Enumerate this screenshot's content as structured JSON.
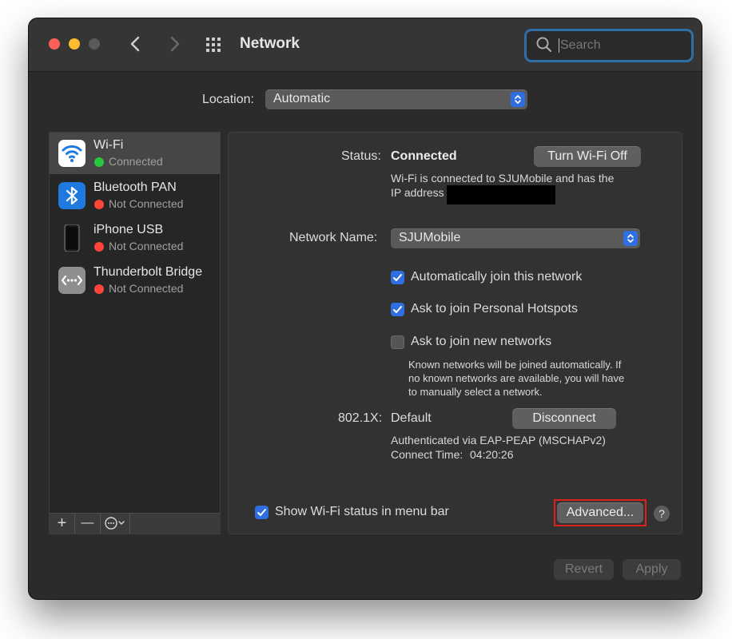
{
  "window": {
    "title": "Network",
    "search_placeholder": "Search"
  },
  "location": {
    "label": "Location:",
    "value": "Automatic"
  },
  "services": [
    {
      "name": "Wi-Fi",
      "status": "Connected",
      "status_color": "#2ac840",
      "icon": "wifi-icon"
    },
    {
      "name": "Bluetooth PAN",
      "status": "Not Connected",
      "status_color": "#ff453a",
      "icon": "bluetooth-icon"
    },
    {
      "name": "iPhone USB",
      "status": "Not Connected",
      "status_color": "#ff453a",
      "icon": "iphone-icon"
    },
    {
      "name": "Thunderbolt Bridge",
      "status": "Not Connected",
      "status_color": "#ff453a",
      "icon": "thunderbolt-bridge-icon"
    }
  ],
  "sidebar_toolbar": {
    "add": "+",
    "remove": "—"
  },
  "detail": {
    "status_label": "Status:",
    "status_value": "Connected",
    "turn_off_button": "Turn Wi-Fi Off",
    "status_desc_line1": "Wi-Fi is connected to SJUMobile and has the",
    "status_desc_line2": "IP address",
    "network_name_label": "Network Name:",
    "network_name_value": "SJUMobile",
    "auto_join": {
      "label": "Automatically join this network",
      "checked": true
    },
    "hotspots": {
      "label": "Ask to join Personal Hotspots",
      "checked": true
    },
    "new_networks": {
      "label": "Ask to join new networks",
      "checked": false
    },
    "known_note_line1": "Known networks will be joined automatically. If",
    "known_note_line2": "no known networks are available, you will have",
    "known_note_line3": "to manually select a network.",
    "dot1x_label": "802.1X:",
    "dot1x_value": "Default",
    "disconnect_button": "Disconnect",
    "auth_line": "Authenticated via EAP-PEAP (MSCHAPv2)",
    "connect_time_label": "Connect Time:",
    "connect_time_value": "04:20:26",
    "show_status": {
      "label": "Show Wi-Fi status in menu bar",
      "checked": true
    },
    "advanced_button": "Advanced...",
    "help": "?"
  },
  "footer": {
    "revert": "Revert",
    "apply": "Apply"
  },
  "colors": {
    "accent": "#2f6fe2",
    "annotation_highlight": "#e0201b"
  }
}
